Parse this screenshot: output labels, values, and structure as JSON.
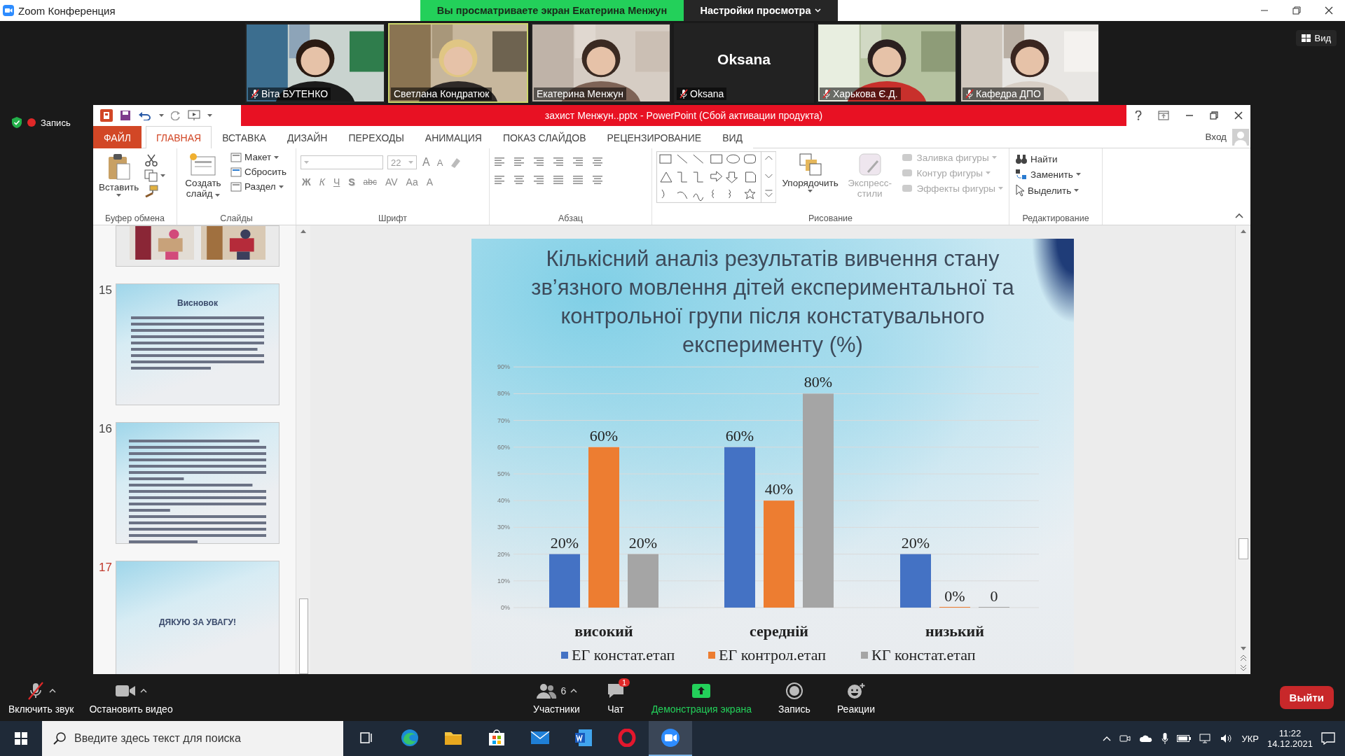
{
  "zoom_window": {
    "title": "Zoom Конференция",
    "share_banner": "Вы просматриваете экран Екатерина Менжун",
    "view_options": "Настройки просмотра",
    "view_button": "Вид"
  },
  "participants": [
    {
      "name": "Віта БУТЕНКО",
      "muted": true,
      "video": true,
      "speaking": false
    },
    {
      "name": "Светлана Кондратюк",
      "muted": false,
      "video": true,
      "speaking": true
    },
    {
      "name": "Екатерина Менжун",
      "muted": false,
      "video": true,
      "speaking": false
    },
    {
      "name": "Oksana",
      "avatar_text": "Oksana",
      "muted": true,
      "video": false,
      "speaking": false
    },
    {
      "name": "Харькова Є.Д.",
      "muted": true,
      "video": true,
      "speaking": false
    },
    {
      "name": "Кафедра ДПО",
      "muted": true,
      "video": true,
      "speaking": false
    }
  ],
  "recording_label": "Запись",
  "powerpoint": {
    "title": "захист Менжун..pptx -  PowerPoint (Сбой активации продукта)",
    "tabs": [
      {
        "label": "ФАЙЛ",
        "kind": "file",
        "selected": false
      },
      {
        "label": "ГЛАВНАЯ",
        "kind": "tab",
        "selected": true
      },
      {
        "label": "ВСТАВКА",
        "kind": "tab",
        "selected": false
      },
      {
        "label": "ДИЗАЙН",
        "kind": "tab",
        "selected": false
      },
      {
        "label": "ПЕРЕХОДЫ",
        "kind": "tab",
        "selected": false
      },
      {
        "label": "АНИМАЦИЯ",
        "kind": "tab",
        "selected": false
      },
      {
        "label": "ПОКАЗ СЛАЙДОВ",
        "kind": "tab",
        "selected": false
      },
      {
        "label": "РЕЦЕНЗИРОВАНИЕ",
        "kind": "tab",
        "selected": false
      },
      {
        "label": "ВИД",
        "kind": "tab",
        "selected": false
      }
    ],
    "sign_in": "Вход",
    "ribbon": {
      "groups": [
        {
          "label": "Буфер обмена",
          "kind": "clipboard",
          "big": "Вставить"
        },
        {
          "label": "Слайды",
          "kind": "slides",
          "big": "Создать слайд",
          "items": [
            "Макет",
            "Сбросить",
            "Раздел"
          ]
        },
        {
          "label": "Шрифт",
          "kind": "font",
          "font_size": "22",
          "size_buttons": [
            "A",
            "A"
          ],
          "buttons": [
            "Ж",
            "К",
            "Ч",
            "S",
            "abc",
            "AV",
            "Aa",
            "A"
          ]
        },
        {
          "label": "Абзац",
          "kind": "paragraph"
        },
        {
          "label": "Рисование",
          "kind": "drawing",
          "arrange": "Упорядочить",
          "quick_styles": {
            "label": "Экспресс-стили",
            "disabled": true
          },
          "items": [
            {
              "label": "Заливка фигуры",
              "disabled": true
            },
            {
              "label": "Контур фигуры",
              "disabled": true
            },
            {
              "label": "Эффекты фигуры",
              "disabled": true
            }
          ]
        },
        {
          "label": "Редактирование",
          "kind": "editing",
          "items": [
            "Найти",
            "Заменить",
            "Выделить"
          ]
        }
      ]
    },
    "slides": [
      {
        "kind": "photos",
        "selected": false
      },
      {
        "number": "15",
        "kind": "text",
        "title": "Висновок",
        "selected": false
      },
      {
        "number": "16",
        "kind": "text",
        "selected": false
      },
      {
        "number": "17",
        "kind": "title",
        "title": "ДЯКУЮ ЗА УВАГУ!",
        "selected": true
      }
    ],
    "current_slide": {
      "title": "Кількісний аналіз результатів вивчення стану зв’язного мовлення дітей експериментальної та контрольної групи після констатувального експерименту (%)",
      "chart_data": {
        "type": "bar",
        "categories": [
          "високий",
          "середній",
          "низький"
        ],
        "series": [
          {
            "name": "ЕГ констат.етап",
            "color": "#4472c4",
            "values": [
              20,
              60,
              20
            ],
            "value_labels": [
              "20%",
              "60%",
              "20%"
            ]
          },
          {
            "name": "ЕГ контрол.етап",
            "color": "#ed7d31",
            "values": [
              60,
              40,
              0
            ],
            "value_labels": [
              "60%",
              "40%",
              "0%"
            ]
          },
          {
            "name": "КГ констат.етап",
            "color": "#a5a5a5",
            "values": [
              20,
              80,
              0
            ],
            "value_labels": [
              "20%",
              "80%",
              "0"
            ]
          }
        ],
        "ylim": [
          0,
          90
        ],
        "yticks": [
          {
            "value": 0,
            "label": "0%"
          },
          {
            "value": 10,
            "label": "10%"
          },
          {
            "value": 20,
            "label": "20%"
          },
          {
            "value": 30,
            "label": "30%"
          },
          {
            "value": 40,
            "label": "40%"
          },
          {
            "value": 50,
            "label": "50%"
          },
          {
            "value": 60,
            "label": "60%"
          },
          {
            "value": 70,
            "label": "70%"
          },
          {
            "value": 80,
            "label": "80%"
          },
          {
            "value": 90,
            "label": "90%"
          }
        ],
        "data_labels": true,
        "grid": true,
        "legend": true
      }
    }
  },
  "controls": [
    {
      "kind": "audio",
      "label": "Включить звук",
      "muted": true
    },
    {
      "kind": "video",
      "label": "Остановить видео"
    },
    {
      "kind": "participants",
      "label": "Участники",
      "count": "6"
    },
    {
      "kind": "chat",
      "label": "Чат",
      "badge": "1"
    },
    {
      "kind": "share",
      "label": "Демонстрация экрана"
    },
    {
      "kind": "record",
      "label": "Запись"
    },
    {
      "kind": "reactions",
      "label": "Реакции"
    }
  ],
  "leave_button": "Выйти",
  "taskbar": {
    "search_placeholder": "Введите здесь текст для поиска",
    "apps": [
      {
        "kind": "taskview",
        "active": false
      },
      {
        "kind": "edge",
        "active": false
      },
      {
        "kind": "explorer",
        "active": false
      },
      {
        "kind": "store",
        "active": false
      },
      {
        "kind": "mail",
        "active": false
      },
      {
        "kind": "word",
        "active": false
      },
      {
        "kind": "opera",
        "active": false
      },
      {
        "kind": "zoom",
        "active": true
      }
    ],
    "language": "УКР",
    "time": "11:22",
    "date": "14.12.2021"
  }
}
